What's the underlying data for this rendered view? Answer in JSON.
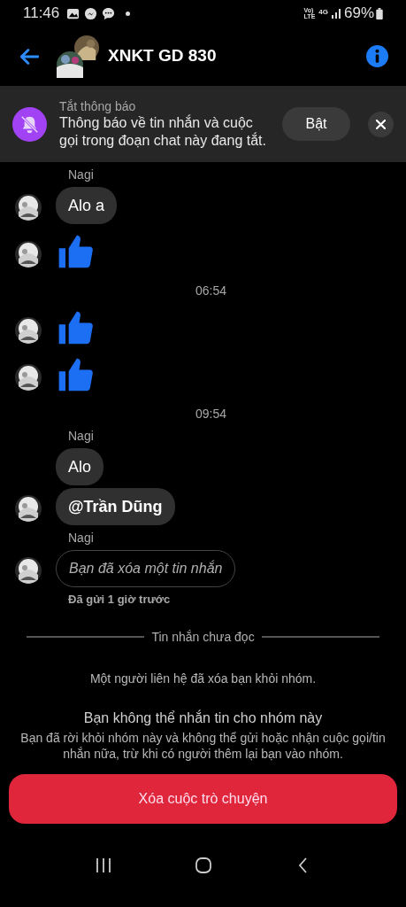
{
  "status_bar": {
    "time": "11:46",
    "network_top": "Vo)",
    "network_bottom": "LTE",
    "data": "4G",
    "battery": "69%"
  },
  "header": {
    "title": "XNKT GD 830"
  },
  "banner": {
    "label": "Tắt thông báo",
    "text": "Thông báo về tin nhắn và cuộc gọi trong đoạn chat này đang tắt.",
    "button": "Bật"
  },
  "messages": [
    {
      "kind": "sender",
      "text": "Nagi",
      "avatar": false
    },
    {
      "kind": "text",
      "text": "Alo a",
      "avatar": true
    },
    {
      "kind": "like",
      "avatar": true
    },
    {
      "kind": "time",
      "text": "06:54"
    },
    {
      "kind": "like",
      "avatar": true
    },
    {
      "kind": "like",
      "avatar": true
    },
    {
      "kind": "time",
      "text": "09:54"
    },
    {
      "kind": "sender",
      "text": "Nagi",
      "avatar": false
    },
    {
      "kind": "text",
      "text": "Alo",
      "avatar": false
    },
    {
      "kind": "mention",
      "text": "@Trần Dũng",
      "avatar": true
    },
    {
      "kind": "sender",
      "text": "Nagi",
      "avatar": false
    },
    {
      "kind": "deleted",
      "text": "Bạn đã xóa một tin nhắn",
      "avatar": true
    },
    {
      "kind": "status",
      "text": "Đã gửi 1 giờ trước",
      "avatar": false
    }
  ],
  "unread_divider": "Tin nhắn chưa đọc",
  "notice": "Một người liên hệ đã xóa bạn khỏi nhóm.",
  "blocked": {
    "title": "Bạn không thể nhắn tin cho nhóm này",
    "text": "Bạn đã rời khỏi nhóm này và không thể gửi hoặc nhận cuộc gọi/tin nhắn nữa, trừ khi có người thêm lại bạn vào nhóm."
  },
  "delete_button": "Xóa cuộc trò chuyện"
}
